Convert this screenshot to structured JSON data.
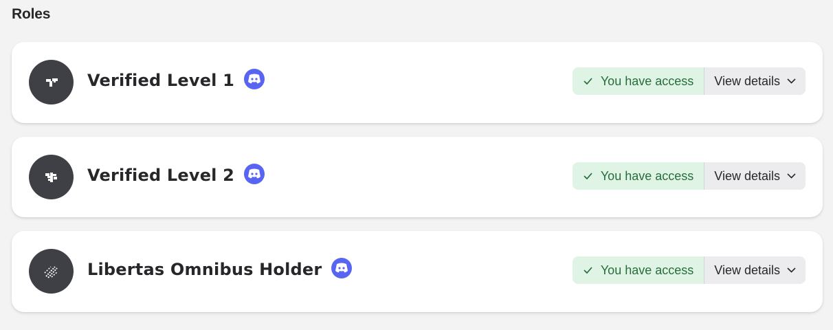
{
  "section": {
    "title": "Roles"
  },
  "roles": [
    {
      "name": "Verified Level 1",
      "platform_icon": "discord-icon",
      "avatar_icon": "sprout-icon",
      "access_label": "You have access",
      "details_label": "View details"
    },
    {
      "name": "Verified Level 2",
      "platform_icon": "discord-icon",
      "avatar_icon": "plant-icon",
      "access_label": "You have access",
      "details_label": "View details"
    },
    {
      "name": "Libertas Omnibus Holder",
      "platform_icon": "discord-icon",
      "avatar_icon": "lightning-icon",
      "access_label": "You have access",
      "details_label": "View details"
    }
  ],
  "colors": {
    "background": "#f3f3f3",
    "card": "#ffffff",
    "avatar": "#3f3f46",
    "discord": "#5865f2",
    "access_bg": "#e0f4e6",
    "access_text": "#276d3c",
    "details_bg": "#ececee"
  }
}
